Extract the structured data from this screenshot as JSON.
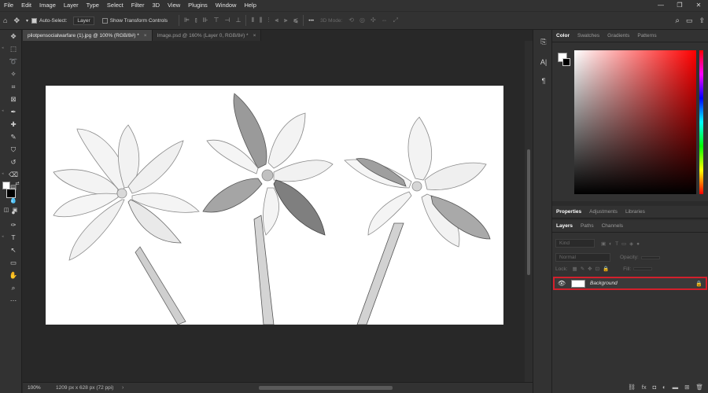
{
  "menu": [
    "File",
    "Edit",
    "Image",
    "Layer",
    "Type",
    "Select",
    "Filter",
    "3D",
    "View",
    "Plugins",
    "Window",
    "Help"
  ],
  "window_controls": {
    "minimize": "—",
    "restore": "❐",
    "close": "✕"
  },
  "options_bar": {
    "auto_select_label": "Auto-Select:",
    "auto_select_value": "Layer",
    "transform_controls_label": "Show Transform Controls",
    "three_d_mode_label": "3D Mode:",
    "more_label": "•••"
  },
  "tabs": [
    {
      "label": "pilotpensocialwarfare (1).jpg @ 100% (RGB/8#) *",
      "close": "×",
      "active": true
    },
    {
      "label": "Image.psd @ 160% (Layer 0, RGB/8#) *",
      "close": "×",
      "active": false
    }
  ],
  "status": {
    "zoom": "100%",
    "doc_info": "1209 px x 628 px (72 ppi)",
    "arrow": "›"
  },
  "panels": {
    "color_tabs": [
      "Color",
      "Swatches",
      "Gradients",
      "Patterns"
    ],
    "properties_tabs": [
      "Properties",
      "Adjustments",
      "Libraries"
    ],
    "layers_tabs": [
      "Layers",
      "Paths",
      "Channels"
    ],
    "kind_placeholder": "Kind",
    "blend_mode": "Normal",
    "opacity_label": "Opacity:",
    "lock_label": "Lock:",
    "fill_label": "Fill:",
    "layer_name": "Background"
  },
  "colors": {
    "accent_selection": "#d2202c",
    "foreground": "#ffffff",
    "background": "#000000"
  }
}
